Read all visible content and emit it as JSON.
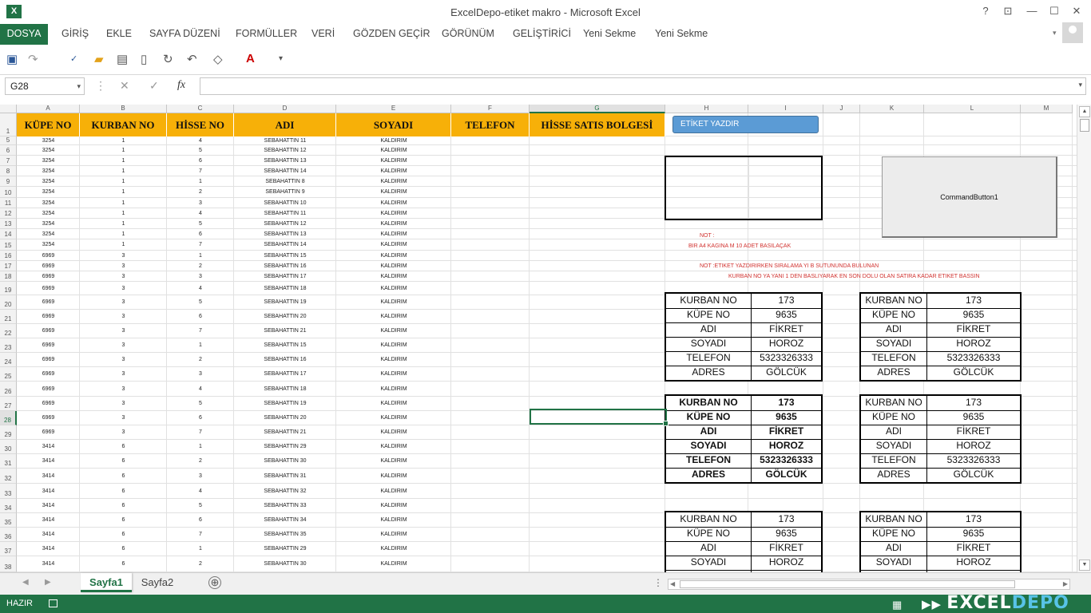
{
  "window": {
    "title": "ExcelDepo-etiket makro - Microsoft Excel",
    "app_icon": "X",
    "help": "?",
    "ribbon_display": "⊡",
    "minimize": "—",
    "maximize": "☐",
    "close": "✕"
  },
  "ribbon": {
    "tabs": [
      "DOSYA",
      "GİRİŞ",
      "EKLE",
      "SAYFA DÜZENİ",
      "FORMÜLLER",
      "VERİ",
      "GÖZDEN GEÇİR",
      "GÖRÜNÜM",
      "GELİŞTİRİCİ",
      "Yeni Sekme",
      "Yeni Sekme"
    ]
  },
  "formula_bar": {
    "name_box": "G28",
    "formula": "",
    "cancel": "✕",
    "enter": "✓",
    "fx": "fx"
  },
  "columns": [
    "A",
    "B",
    "C",
    "D",
    "E",
    "F",
    "G",
    "H",
    "I",
    "J",
    "K",
    "L",
    "M"
  ],
  "selected_column": "G",
  "rows": [
    1,
    5,
    6,
    7,
    8,
    9,
    10,
    11,
    12,
    13,
    14,
    15,
    16,
    17,
    18,
    19,
    20,
    21,
    22,
    23,
    24,
    25,
    26,
    27,
    28,
    29,
    30,
    31,
    32,
    33,
    34,
    35,
    36,
    37,
    38
  ],
  "selected_row": 28,
  "header_row": [
    "KÜPE NO",
    "KURBAN  NO",
    "HİSSE NO",
    "ADI",
    "SOYADI",
    "TELEFON",
    "HİSSE SATIS BOLGESİ"
  ],
  "data_rows": [
    [
      "3254",
      "1",
      "4",
      "SEBAHATTIN 11",
      "KALDIRIM"
    ],
    [
      "3254",
      "1",
      "5",
      "SEBAHATTIN 12",
      "KALDIRIM"
    ],
    [
      "3254",
      "1",
      "6",
      "SEBAHATTIN 13",
      "KALDIRIM"
    ],
    [
      "3254",
      "1",
      "7",
      "SEBAHATTIN 14",
      "KALDIRIM"
    ],
    [
      "3254",
      "1",
      "1",
      "SEBAHATTIN 8",
      "KALDIRIM"
    ],
    [
      "3254",
      "1",
      "2",
      "SEBAHATTIN 9",
      "KALDIRIM"
    ],
    [
      "3254",
      "1",
      "3",
      "SEBAHATTIN 10",
      "KALDIRIM"
    ],
    [
      "3254",
      "1",
      "4",
      "SEBAHATTIN 11",
      "KALDIRIM"
    ],
    [
      "3254",
      "1",
      "5",
      "SEBAHATTIN 12",
      "KALDIRIM"
    ],
    [
      "3254",
      "1",
      "6",
      "SEBAHATTIN 13",
      "KALDIRIM"
    ],
    [
      "3254",
      "1",
      "7",
      "SEBAHATTIN 14",
      "KALDIRIM"
    ],
    [
      "6969",
      "3",
      "1",
      "SEBAHATTIN 15",
      "KALDIRIM"
    ],
    [
      "6969",
      "3",
      "2",
      "SEBAHATTIN 16",
      "KALDIRIM"
    ],
    [
      "6969",
      "3",
      "3",
      "SEBAHATTIN 17",
      "KALDIRIM"
    ],
    [
      "6969",
      "3",
      "4",
      "SEBAHATTIN 18",
      "KALDIRIM"
    ],
    [
      "6969",
      "3",
      "5",
      "SEBAHATTIN 19",
      "KALDIRIM"
    ],
    [
      "6969",
      "3",
      "6",
      "SEBAHATTIN 20",
      "KALDIRIM"
    ],
    [
      "6969",
      "3",
      "7",
      "SEBAHATTIN 21",
      "KALDIRIM"
    ],
    [
      "6969",
      "3",
      "1",
      "SEBAHATTIN 15",
      "KALDIRIM"
    ],
    [
      "6969",
      "3",
      "2",
      "SEBAHATTIN 16",
      "KALDIRIM"
    ],
    [
      "6969",
      "3",
      "3",
      "SEBAHATTIN 17",
      "KALDIRIM"
    ],
    [
      "6969",
      "3",
      "4",
      "SEBAHATTIN 18",
      "KALDIRIM"
    ],
    [
      "6969",
      "3",
      "5",
      "SEBAHATTIN 19",
      "KALDIRIM"
    ],
    [
      "6969",
      "3",
      "6",
      "SEBAHATTIN 20",
      "KALDIRIM"
    ],
    [
      "6969",
      "3",
      "7",
      "SEBAHATTIN 21",
      "KALDIRIM"
    ],
    [
      "3414",
      "6",
      "1",
      "SEBAHATTIN 29",
      "KALDIRIM"
    ],
    [
      "3414",
      "6",
      "2",
      "SEBAHATTIN 30",
      "KALDIRIM"
    ],
    [
      "3414",
      "6",
      "3",
      "SEBAHATTIN 31",
      "KALDIRIM"
    ],
    [
      "3414",
      "6",
      "4",
      "SEBAHATTIN 32",
      "KALDIRIM"
    ],
    [
      "3414",
      "6",
      "5",
      "SEBAHATTIN 33",
      "KALDIRIM"
    ],
    [
      "3414",
      "6",
      "6",
      "SEBAHATTIN 34",
      "KALDIRIM"
    ],
    [
      "3414",
      "6",
      "7",
      "SEBAHATTIN 35",
      "KALDIRIM"
    ],
    [
      "3414",
      "6",
      "1",
      "SEBAHATTIN 29",
      "KALDIRIM"
    ],
    [
      "3414",
      "6",
      "2",
      "SEBAHATTIN 30",
      "KALDIRIM"
    ]
  ],
  "buttons": {
    "etiket_yazdir": "ETİKET YAZDIR",
    "command_button": "CommandButton1"
  },
  "notes": [
    "NOT :",
    "BIR A4 KAGINA M 10 ADET BASILAÇAK",
    "NOT :ETIKET YAZDIRIRKEN SIRALAMA YI B SUTUNUNDA BULUNAN",
    "KURBAN  NO YA  YANI 1 DEN BASLIYARAK EN SON DOLU OLAN SATIRA KADAR ETIKET BASSIN"
  ],
  "label_fields": [
    "KURBAN NO",
    "KÜPE NO",
    "ADI",
    "SOYADI",
    "TELEFON",
    "ADRES"
  ],
  "label_values": [
    "173",
    "9635",
    "FİKRET",
    "HOROZ",
    "5323326333",
    "GÖLCÜK"
  ],
  "sheets": {
    "tabs": [
      "Sayfa1",
      "Sayfa2"
    ],
    "active": "Sayfa1",
    "add": "⊕"
  },
  "status": {
    "mode": "HAZIR"
  },
  "watermark": {
    "part1": "EXCEL",
    "part2": "DEPO"
  }
}
